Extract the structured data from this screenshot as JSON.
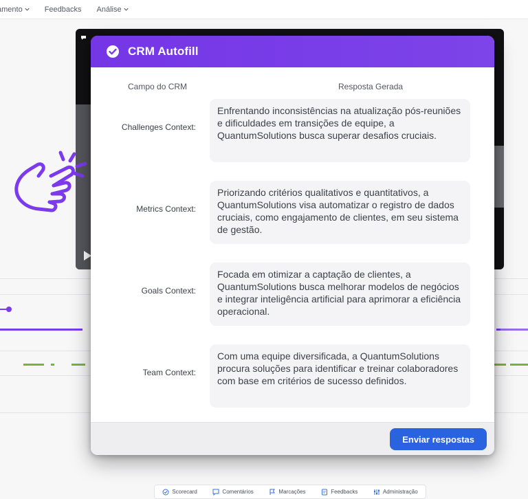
{
  "topnav": {
    "items": [
      {
        "label": "amento",
        "has_chevron": true
      },
      {
        "label": "Feedbacks",
        "has_chevron": false
      },
      {
        "label": "Análise",
        "has_chevron": true
      }
    ]
  },
  "modal": {
    "title": "CRM Autofill",
    "header_color": "#7a3be8",
    "col_field": "Campo do CRM",
    "col_answer": "Resposta Gerada",
    "rows": [
      {
        "label": "Challenges Context:",
        "answer": "Enfrentando inconsistências na atualização pós-reuniões e dificuldades em transições de equipe, a QuantumSolutions busca superar desafios cruciais."
      },
      {
        "label": "Metrics Context:",
        "answer": "Priorizando critérios qualitativos e quantitativos, a QuantumSolutions visa automatizar o registro de dados cruciais, como engajamento de clientes, em seu sistema de gestão."
      },
      {
        "label": "Goals Context:",
        "answer": "Focada em otimizar a captação de clientes, a QuantumSolutions busca melhorar modelos de negócios e integrar inteligência artificial para aprimorar a eficiência operacional."
      },
      {
        "label": "Team Context:",
        "answer": "Com uma equipe diversificada, a QuantumSolutions procura soluções para identificar e treinar colaboradores com base em critérios de sucesso definidos."
      }
    ],
    "submit_label": "Enviar respostas",
    "submit_color": "#2a63e0"
  },
  "bottombar": {
    "items": [
      {
        "label": "Scorecard",
        "icon": "check-circle-icon"
      },
      {
        "label": "Comentários",
        "icon": "comment-icon"
      },
      {
        "label": "Marcações",
        "icon": "flag-icon"
      },
      {
        "label": "Feedbacks",
        "icon": "feedback-icon"
      },
      {
        "label": "Administração",
        "icon": "sliders-icon"
      }
    ]
  },
  "accent_color": "#7c3aed"
}
